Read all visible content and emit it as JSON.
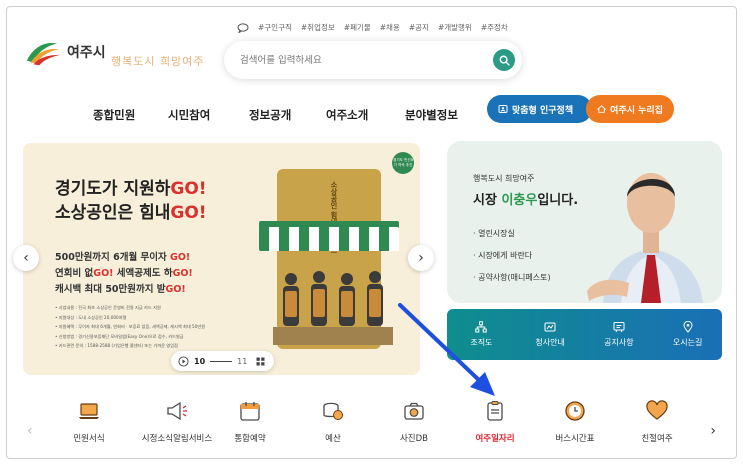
{
  "header": {
    "logo_text": "여주시",
    "slogan": "행복도시 희망여주",
    "keywords": [
      "#구인구직",
      "#취업정보",
      "#폐기물",
      "#채용",
      "#공지",
      "#개발행위",
      "#주정차"
    ],
    "search_placeholder": "검색어를 입력하세요"
  },
  "nav": {
    "items": [
      "종합민원",
      "시민참여",
      "정보공개",
      "여주소개",
      "분야별정보"
    ],
    "pill_policy": "맞춤형 인구정책",
    "pill_nurijip": "여주시 누리집"
  },
  "banner": {
    "headline_1a": "경기도가 지원하",
    "headline_1b": "GO!",
    "headline_2a": "소상공인은 힘내",
    "headline_2b": "GO!",
    "line_1a": "500만원까지 6개월 무이자 ",
    "line_1b": "GO!",
    "line_2a": "연회비 없",
    "line_2b": "GO!",
    "line_2c": " 세액공제도 하",
    "line_2d": "GO!",
    "line_3a": "캐시백 최대 50만원까지 받",
    "line_3b": "GO!",
    "details": [
      "• 사업내용 : 전국 최초 소상공인 운영비 전용 지급 카드 지원",
      "• 지원대상 : 도내 소상공인 20,000여명",
      "• 지원혜택 : 무이자 최대 6개월, 연회비 · 보증료 없음, 세액공제, 캐시백 최대 50만원",
      "• 신청방법 : 경기신용보증재단 모바일앱(Easy One)으로 접수, 카드발급",
      "• 카드관련 문의 : 1588-2588 (기업은행 콜센터) 또는 가까운 영업점"
    ],
    "card_text": "소상공인 힘내GO 카드",
    "badge": "경기도 민선8기 약속 추진",
    "slide_current": "10",
    "slide_total": "11"
  },
  "mayor": {
    "subtitle": "행복도시 희망여주",
    "title_prefix": "시장 ",
    "name": "이충우",
    "title_suffix": "입니다.",
    "links": [
      "· 열린시장실",
      "· 시장에게 바란다",
      "· 공약사항(매니페스토)"
    ]
  },
  "quick": [
    "조직도",
    "청사안내",
    "공지사항",
    "오시는길"
  ],
  "menu": [
    "민원서식",
    "시정소식알림서비스",
    "통합예약",
    "예산",
    "사진DB",
    "여주일자리",
    "버스시간표",
    "친절여주"
  ],
  "colors": {
    "accent_green": "#2b9a86",
    "pill_blue": "#1a73b8",
    "pill_orange": "#ef7a1f",
    "go_red": "#d8322e",
    "active_red": "#e0252d",
    "pointer_blue": "#1e4fe0"
  }
}
